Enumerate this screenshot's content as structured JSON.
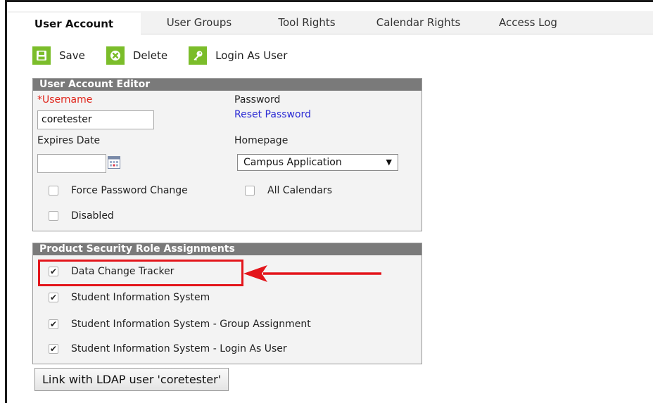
{
  "tabs": [
    "User Account",
    "User Groups",
    "Tool Rights",
    "Calendar Rights",
    "Access Log"
  ],
  "toolbar": {
    "save": "Save",
    "delete": "Delete",
    "login_as_user": "Login As User"
  },
  "editor": {
    "header": "User Account Editor",
    "username_required_mark": "*",
    "username_label": "Username",
    "username_value": "coretester",
    "password_label": "Password",
    "reset_password": "Reset Password",
    "expires_label": "Expires Date",
    "expires_value": "",
    "homepage_label": "Homepage",
    "homepage_value": "Campus Application",
    "force_password_change": "Force Password Change",
    "force_password_change_checked": false,
    "all_calendars": "All Calendars",
    "all_calendars_checked": false,
    "disabled": "Disabled",
    "disabled_checked": false
  },
  "roles": {
    "header": "Product Security Role Assignments",
    "items": [
      {
        "label": "Data Change Tracker",
        "checked": true
      },
      {
        "label": "Student Information System",
        "checked": true
      },
      {
        "label": "Student Information System - Group Assignment",
        "checked": true
      },
      {
        "label": "Student Information System - Login As User",
        "checked": true
      }
    ]
  },
  "ldap_button": "Link with LDAP user 'coretester'",
  "colors": {
    "icon_green": "#7bbd2a",
    "panel_header": "#7a7a7a",
    "required_red": "#e0251b",
    "link_blue": "#2b2bd4",
    "annotation_red": "#e3151b"
  }
}
